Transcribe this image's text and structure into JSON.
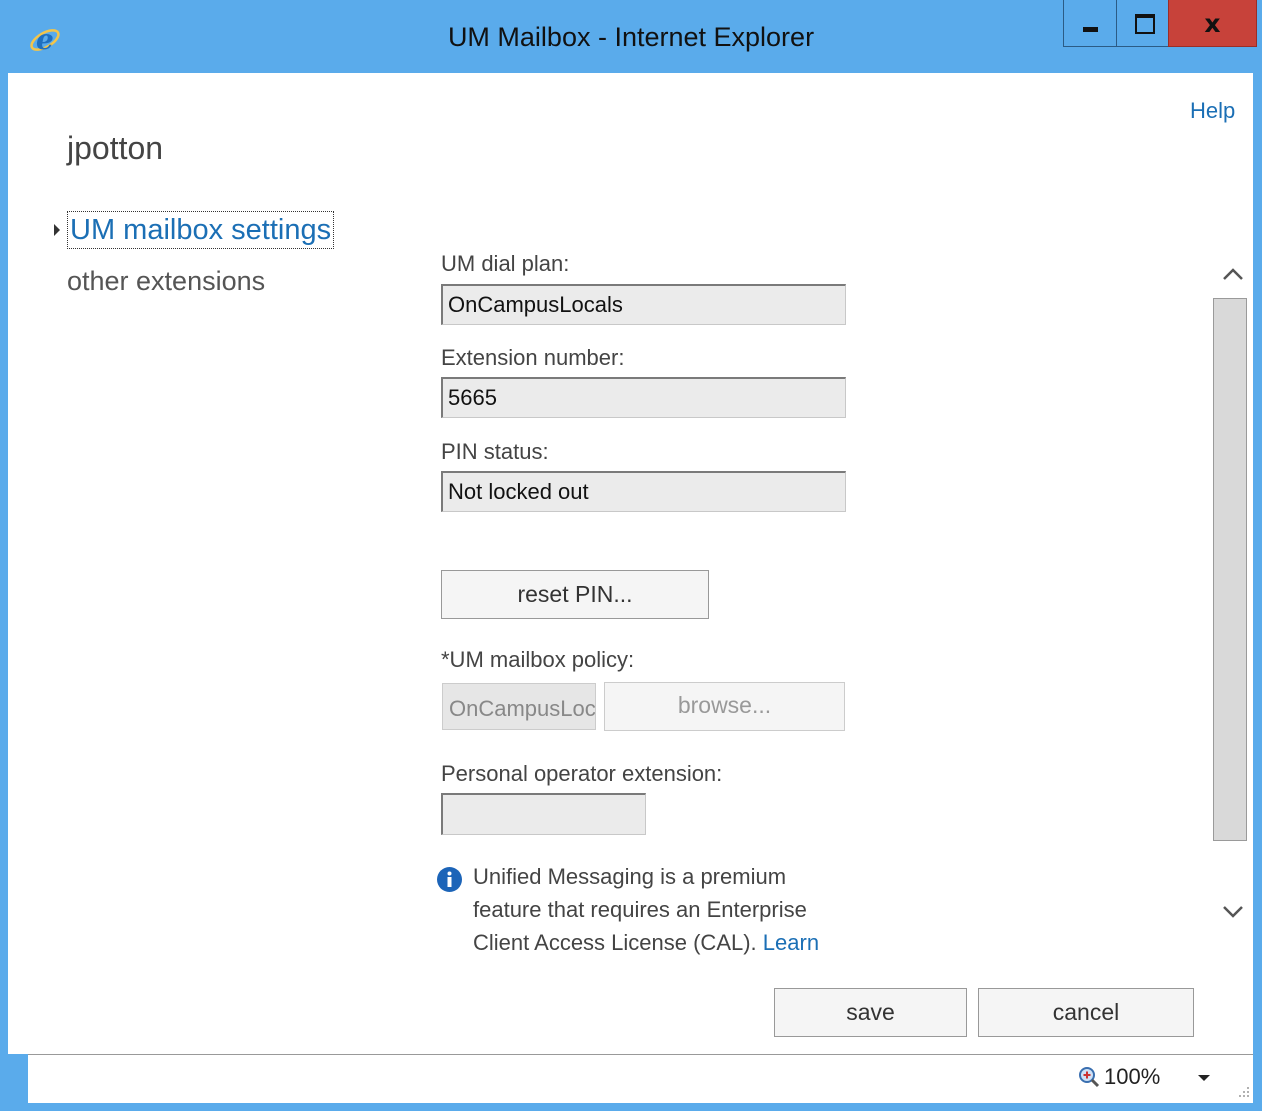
{
  "window": {
    "title": "UM Mailbox - Internet Explorer",
    "close_label": "x"
  },
  "header": {
    "help_label": "Help",
    "page_title": "jpotton"
  },
  "nav": {
    "items": [
      {
        "label": "UM mailbox settings",
        "active": true
      },
      {
        "label": "other extensions",
        "active": false
      }
    ]
  },
  "form": {
    "dial_plan_label": "UM dial plan:",
    "dial_plan_value": "OnCampusLocals",
    "extension_label": "Extension number:",
    "extension_value": "5665",
    "pin_status_label": "PIN status:",
    "pin_status_value": "Not locked out",
    "reset_pin_label": "reset PIN...",
    "policy_label": "*UM mailbox policy:",
    "policy_value": "OnCampusLocals",
    "browse_label": "browse...",
    "operator_label": "Personal operator extension:",
    "operator_value": ""
  },
  "info": {
    "text": "Unified Messaging is a premium feature that requires an Enterprise Client Access License (CAL).",
    "link_label": "Learn"
  },
  "actions": {
    "save_label": "save",
    "cancel_label": "cancel"
  },
  "status": {
    "zoom": "100%"
  },
  "colors": {
    "titlebar": "#5aabeb",
    "link": "#1b6fb5",
    "close": "#c7423a"
  }
}
